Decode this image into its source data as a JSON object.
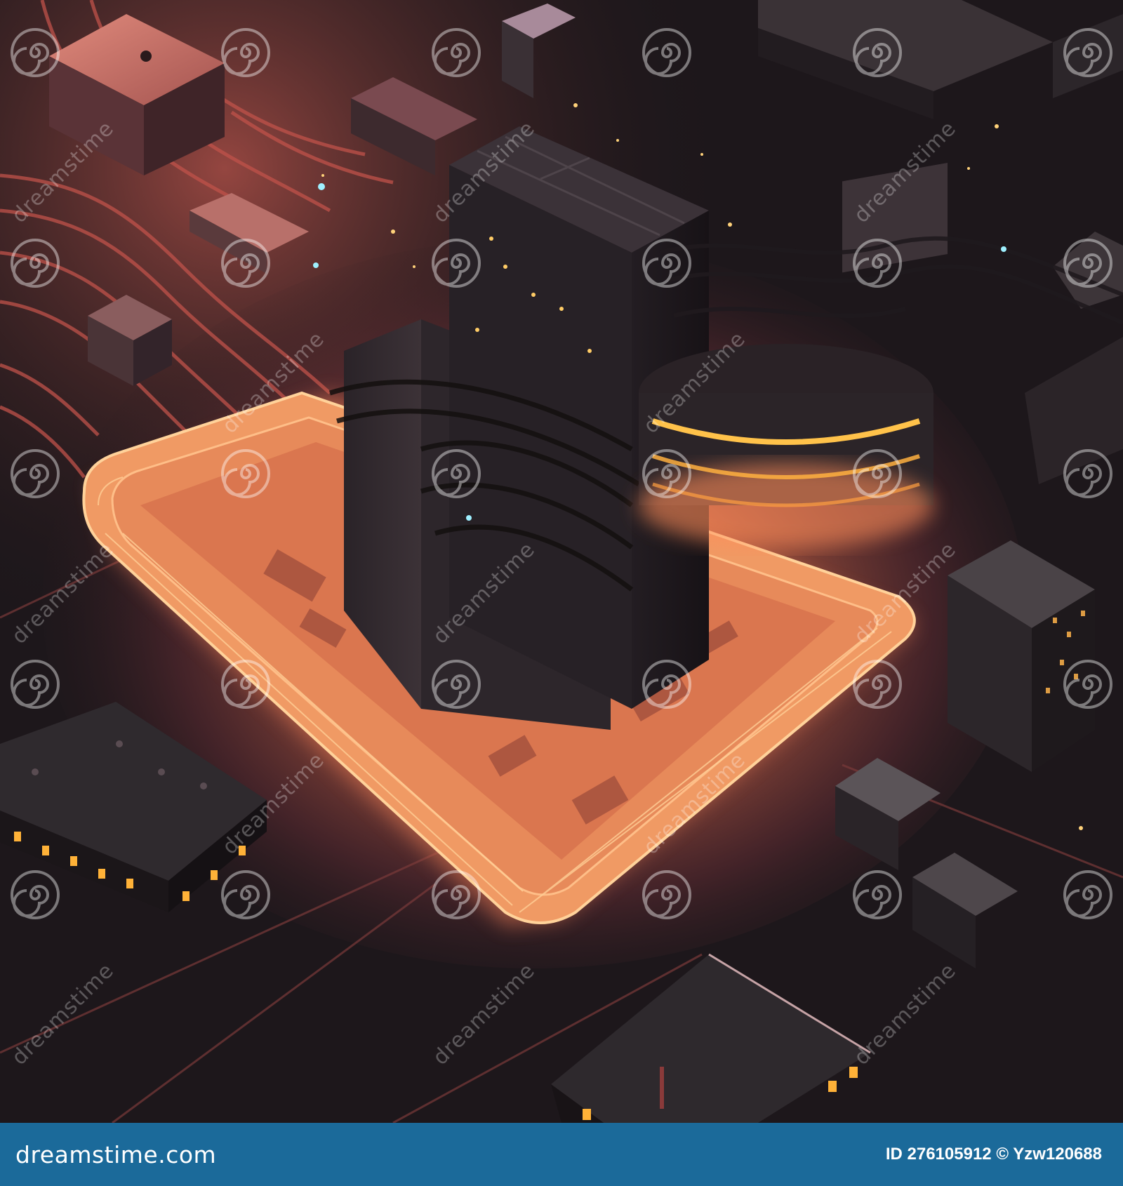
{
  "watermark": {
    "brand": "dreamstime",
    "spiral_icon": "dreamstime-spiral-icon"
  },
  "footer": {
    "site": "dreamstime.com",
    "image_id": "ID 276105912",
    "separator": "©",
    "author": "Yzw120688",
    "background": "#1b6a9a"
  },
  "scene": {
    "palette": {
      "ground": "#1d171b",
      "glow_orange": "#ff9a4a",
      "glow_red": "#e0604a",
      "roof_dark": "#3a3338",
      "light_amber": "#ffc24a"
    }
  }
}
